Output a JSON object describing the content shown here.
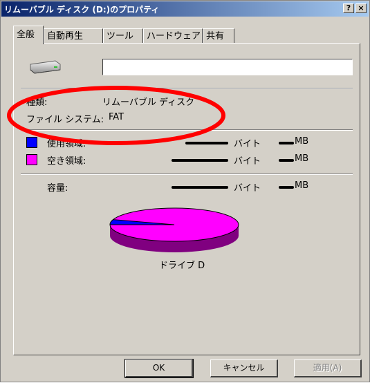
{
  "window": {
    "title": "リムーバブル ディスク (D:)のプロパティ",
    "help_button": "?",
    "close_button": "×"
  },
  "tabs": [
    {
      "label": "全般",
      "active": true
    },
    {
      "label": "自動再生",
      "active": false
    },
    {
      "label": "ツール",
      "active": false
    },
    {
      "label": "ハードウェア",
      "active": false
    },
    {
      "label": "共有",
      "active": false
    }
  ],
  "general": {
    "drive_icon": "removable-drive-icon",
    "name_value": "",
    "type_label": "種類:",
    "type_value": "リムーバブル ディスク",
    "fs_label": "ファイル システム:",
    "fs_value": "FAT",
    "used_label": "使用領域:",
    "free_label": "空き領域:",
    "capacity_label": "容量:",
    "bytes_unit": "バイト",
    "mb_unit": "MB",
    "drive_caption": "ドライブ D",
    "used_color": "#0000ff",
    "free_color": "#ff00ff",
    "used_fraction": 0.05
  },
  "buttons": {
    "ok": "OK",
    "cancel": "キャンセル",
    "apply": "適用(A)"
  },
  "annotation": {
    "shape": "red-ellipse",
    "color": "#ff0000"
  }
}
